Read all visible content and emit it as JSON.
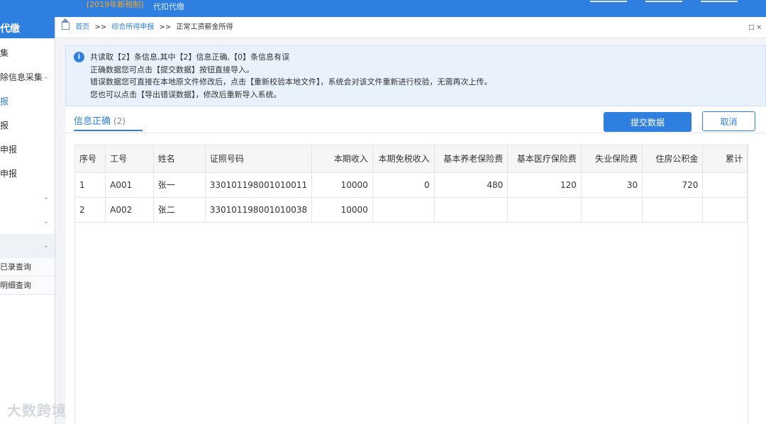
{
  "header": {
    "version": "[2019年新税制]",
    "subtitle": "代扣代缴"
  },
  "sidebar": {
    "title": "代缴",
    "items": [
      {
        "label": "集",
        "active": false
      },
      {
        "label": "除信息采集",
        "active": false
      },
      {
        "label": "报",
        "active": true
      },
      {
        "label": "报",
        "active": false
      },
      {
        "label": "申报",
        "active": false
      },
      {
        "label": "申报",
        "active": false
      }
    ],
    "sub_items": [
      "已录查询",
      "明细查询"
    ]
  },
  "breadcrumb": {
    "home": "首页",
    "sep": ">>",
    "level2": "综合所得申报",
    "current": "正常工资薪金所得"
  },
  "info": {
    "line1": "共读取【2】条信息,其中【2】信息正确,【0】条信息有误",
    "line2": "正确数据您可点击【提交数据】按钮直接导入。",
    "line3": "错误数据您可直接在本地原文件修改后，点击【重新校验本地文件】，系统会对该文件重新进行校验，无需再次上传。",
    "line4": "您也可以点击【导出错误数据】，修改后重新导入系统。"
  },
  "tabs": {
    "correct_label": "信息正确",
    "correct_count": "(2)"
  },
  "buttons": {
    "submit": "提交数据",
    "cancel": "取消"
  },
  "table": {
    "headers": [
      "序号",
      "工号",
      "姓名",
      "证照号码",
      "本期收入",
      "本期免税收入",
      "基本养老保险费",
      "基本医疗保险费",
      "失业保险费",
      "住房公积金",
      "累计"
    ],
    "rows": [
      [
        "1",
        "A001",
        "张一",
        "330101198001010011",
        "10000",
        "0",
        "480",
        "120",
        "30",
        "720",
        ""
      ],
      [
        "2",
        "A002",
        "张二",
        "330101198001010038",
        "10000",
        "",
        "",
        "",
        "",
        "",
        ""
      ]
    ]
  },
  "watermark": "大数跨境"
}
